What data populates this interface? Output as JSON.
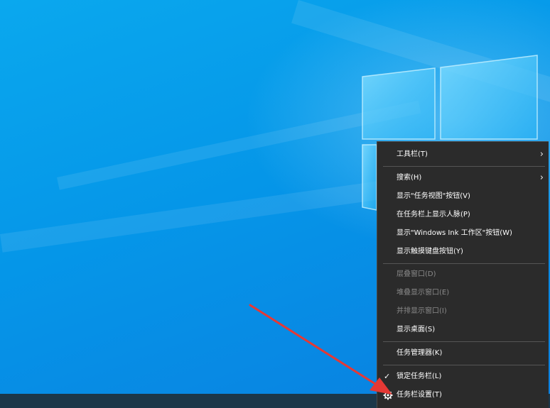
{
  "context_menu": {
    "items": [
      {
        "label": "工具栏(T)",
        "enabled": true,
        "submenu": true
      },
      {
        "label": "搜索(H)",
        "enabled": true,
        "submenu": true
      },
      {
        "label": "显示\"任务视图\"按钮(V)",
        "enabled": true
      },
      {
        "label": "在任务栏上显示人脉(P)",
        "enabled": true
      },
      {
        "label": "显示\"Windows Ink 工作区\"按钮(W)",
        "enabled": true
      },
      {
        "label": "显示触摸键盘按钮(Y)",
        "enabled": true
      },
      {
        "label": "层叠窗口(D)",
        "enabled": false
      },
      {
        "label": "堆叠显示窗口(E)",
        "enabled": false
      },
      {
        "label": "并排显示窗口(I)",
        "enabled": false
      },
      {
        "label": "显示桌面(S)",
        "enabled": true
      },
      {
        "label": "任务管理器(K)",
        "enabled": true
      },
      {
        "label": "锁定任务栏(L)",
        "enabled": true,
        "checked": true
      },
      {
        "label": "任务栏设置(T)",
        "enabled": true,
        "icon": "gear-icon"
      }
    ],
    "submenu_glyph": "›",
    "check_glyph": "✓"
  },
  "colors": {
    "desktop_blue": "#0596e8",
    "menu_bg": "#2b2b2b",
    "annotation_arrow": "#e53935"
  }
}
